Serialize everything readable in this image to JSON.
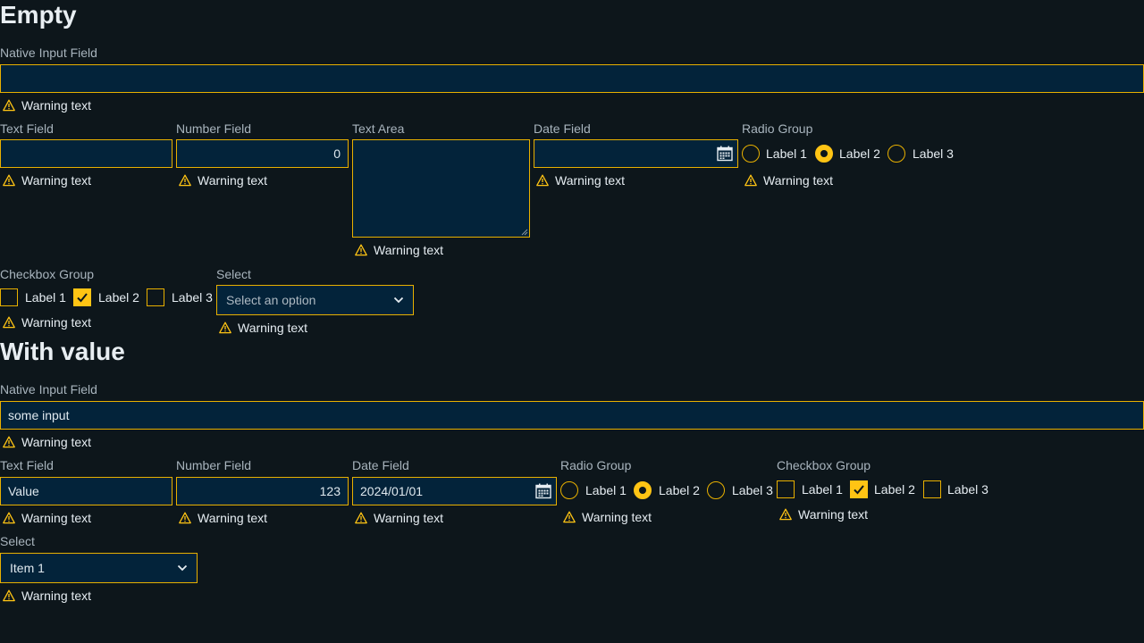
{
  "sections": {
    "empty": {
      "title": "Empty",
      "native": {
        "label": "Native Input Field",
        "value": "",
        "warning": "Warning text"
      },
      "text": {
        "label": "Text Field",
        "value": "",
        "warning": "Warning text"
      },
      "number": {
        "label": "Number Field",
        "value": "0",
        "warning": "Warning text"
      },
      "textarea": {
        "label": "Text Area",
        "value": "",
        "warning": "Warning text"
      },
      "date": {
        "label": "Date Field",
        "value": "",
        "warning": "Warning text"
      },
      "radio": {
        "label": "Radio Group",
        "options": [
          "Label 1",
          "Label 2",
          "Label 3"
        ],
        "selected": "Label 2",
        "warning": "Warning text"
      },
      "checkbox": {
        "label": "Checkbox Group",
        "options": [
          "Label 1",
          "Label 2",
          "Label 3"
        ],
        "checked": [
          "Label 2"
        ],
        "warning": "Warning text"
      },
      "select": {
        "label": "Select",
        "placeholder": "Select an option",
        "warning": "Warning text"
      }
    },
    "with_value": {
      "title": "With value",
      "native": {
        "label": "Native Input Field",
        "value": "some input",
        "warning": "Warning text"
      },
      "text": {
        "label": "Text Field",
        "value": "Value",
        "warning": "Warning text"
      },
      "number": {
        "label": "Number Field",
        "value": "123",
        "warning": "Warning text"
      },
      "date": {
        "label": "Date Field",
        "value": "2024/01/01",
        "warning": "Warning text"
      },
      "radio": {
        "label": "Radio Group",
        "options": [
          "Label 1",
          "Label 2",
          "Label 3"
        ],
        "selected": "Label 2",
        "warning": "Warning text"
      },
      "checkbox": {
        "label": "Checkbox Group",
        "options": [
          "Label 1",
          "Label 2",
          "Label 3"
        ],
        "checked": [
          "Label 2"
        ],
        "warning": "Warning text"
      },
      "select": {
        "label": "Select",
        "value": "Item 1",
        "warning": "Warning text"
      }
    }
  },
  "icons": {
    "warning": "warning-triangle-icon",
    "calendar": "calendar-icon",
    "chevron": "chevron-down-icon",
    "check": "check-icon"
  },
  "colors": {
    "accent": "#ffc414",
    "field_bg": "#03233a",
    "page_bg": "#0d161b"
  }
}
